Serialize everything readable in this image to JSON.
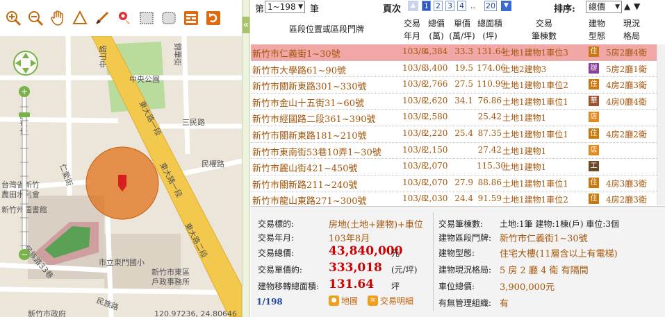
{
  "map": {
    "labels": {
      "zhongyang_park": "中央公園",
      "zhongshan_rd": "中山路",
      "zhongyang_rd": "中央路",
      "sanmin_rd": "三民路",
      "minquan_rd": "民權路",
      "dongda_rd_a": "東大路一段",
      "dongda_rd_b": "東大路一段",
      "dongda_rd_c": "東大路二段",
      "renai_st": "仁愛街",
      "farmers_assoc": "台灣省新竹農田水利會",
      "library": "新竹州圖書館",
      "elementary": "市立東門國小",
      "household_office": "新竹市東區戶政事務所",
      "minzu_rd_a": "民族路33巷",
      "minzu_rd_b": "民族路",
      "jinhua_st": "錦華街",
      "lane_168": "巷168",
      "city_hall": "新竹市政府",
      "coords": "120.97236, 24.80646"
    }
  },
  "splitter": {
    "collapse_glyph": "«"
  },
  "topbar": {
    "di_label": "第",
    "page_select": "1~198",
    "bi_label": "筆",
    "page_label": "頁次",
    "pages": [
      "1",
      "2",
      "3",
      "4"
    ],
    "ellipsis": "..",
    "last_page": "20",
    "sort_label": "排序:",
    "sort_select": "總價",
    "sort_up": "▲",
    "sort_down": "▼"
  },
  "table": {
    "headers": {
      "addr": "區段位置或區段門牌",
      "date_1": "交易",
      "date_2": "年月",
      "total_1": "總價",
      "total_2": "(萬)",
      "unit_1": "單價",
      "unit_2": "(萬/坪)",
      "area_1": "總面積",
      "area_2": "(坪)",
      "tx_1": "交易",
      "tx_2": "筆棟數",
      "type_1": "建物",
      "type_2": "型態",
      "layout_1": "現況",
      "layout_2": "格局"
    },
    "rows": [
      {
        "addr": "新竹市仁義街1~30號",
        "date": "103/8",
        "total": "4,384",
        "unit": "33.3",
        "area": "131.64",
        "tx": "土地1建物1車位3",
        "badge": "住",
        "badge_color": "#c87a10",
        "layout": "5房2廳4衛"
      },
      {
        "addr": "新竹市大學路61~90號",
        "date": "103/8",
        "total": "3,400",
        "unit": "19.5",
        "area": "174.06",
        "tx": "土地2建物3",
        "badge": "辦",
        "badge_color": "#8a3f9a",
        "layout": "5房2廳1衛"
      },
      {
        "addr": "新竹市關新東路301~330號",
        "date": "103/8",
        "total": "2,766",
        "unit": "27.5",
        "area": "110.99",
        "tx": "土地1建物1車位2",
        "badge": "住",
        "badge_color": "#c87a10",
        "layout": "4房2廳3衛"
      },
      {
        "addr": "新竹市金山十五街31~60號",
        "date": "103/8",
        "total": "2,620",
        "unit": "34.1",
        "area": "76.86",
        "tx": "土地1建物1車位1",
        "badge": "華",
        "badge_color": "#a0522d",
        "layout": "4房0廳4衛"
      },
      {
        "addr": "新竹市經國路二段361~390號",
        "date": "103/8",
        "total": "2,580",
        "unit": "",
        "area": "25.42",
        "tx": "土地1建物1",
        "badge": "店",
        "badge_color": "#e08a1e",
        "layout": ""
      },
      {
        "addr": "新竹市關新東路181~210號",
        "date": "103/8",
        "total": "2,220",
        "unit": "25.4",
        "area": "87.35",
        "tx": "土地1建物1車位1",
        "badge": "住",
        "badge_color": "#c87a10",
        "layout": "4房2廳2衛"
      },
      {
        "addr": "新竹市東南街53巷10弄1~30號",
        "date": "103/8",
        "total": "2,150",
        "unit": "",
        "area": "27.42",
        "tx": "土地1建物1",
        "badge": "店",
        "badge_color": "#e08a1e",
        "layout": ""
      },
      {
        "addr": "新竹市麗山街421~450號",
        "date": "103/8",
        "total": "2,070",
        "unit": "",
        "area": "115.30",
        "tx": "土地1建物1",
        "badge": "工",
        "badge_color": "#6b4a2a",
        "layout": ""
      },
      {
        "addr": "新竹市關新路211~240號",
        "date": "103/8",
        "total": "2,070",
        "unit": "27.9",
        "area": "88.86",
        "tx": "土地1建物1車位1",
        "badge": "住",
        "badge_color": "#c87a10",
        "layout": "4房3廳3衛"
      },
      {
        "addr": "新竹市龍山東路271~300號",
        "date": "103/8",
        "total": "2,030",
        "unit": "24.4",
        "area": "91.59",
        "tx": "土地1建物1車位2",
        "badge": "住",
        "badge_color": "#c87a10",
        "layout": "4房2廳3衛"
      }
    ]
  },
  "detail": {
    "target_label": "交易標的:",
    "target_value": "房地(土地+建物)+車位",
    "date_label": "交易年月:",
    "date_value": "103年8月",
    "total_label": "交易總價:",
    "total_value": "43,840,000",
    "total_unit": "元",
    "unit_label": "交易單價約:",
    "unit_value": "333,018",
    "unit_unit": "(元/坪)",
    "area_label": "建物移轉總面積:",
    "area_value": "131.64",
    "area_unit": "坪",
    "counter": "1/198",
    "map_button": "地圖",
    "detail_button": "交易明細",
    "count_label": "交易筆棟數:",
    "count_value": "土地:1筆 建物:1棟(戶) 車位:3個",
    "addr_label": "建物區段門牌:",
    "addr_value": "新竹市仁義街1~30號",
    "type_label": "建物型態:",
    "type_value": "住宅大樓(11層含以上有電梯)",
    "layout_label": "建物現況格局:",
    "layout_value": "5 房 2 廳 4 衛 有隔間",
    "parking_label": "車位總價:",
    "parking_value": "3,900,000元",
    "mgmt_label": "有無管理組織:",
    "mgmt_value": "有"
  }
}
